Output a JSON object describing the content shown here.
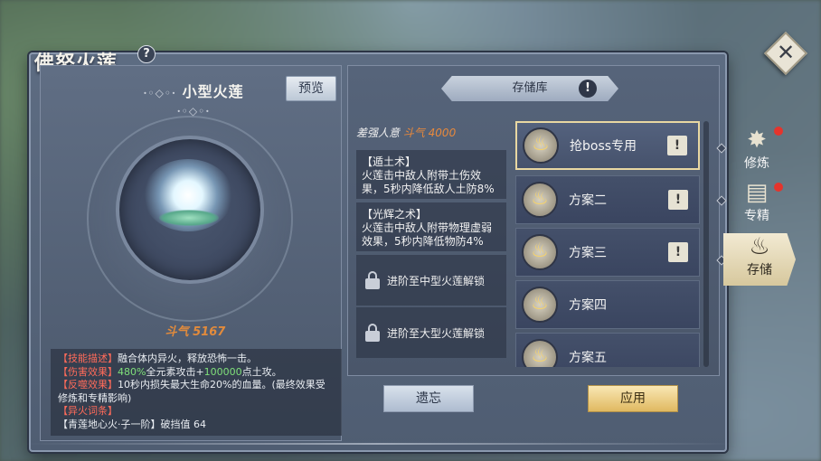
{
  "window": {
    "title": "佛怒火莲",
    "help_icon": "?",
    "close_icon": "✕"
  },
  "left": {
    "skill_name": "小型火莲",
    "preview_label": "预览",
    "douqi": "斗气 5167",
    "description": {
      "tag1": "【技能描述】",
      "text1": "融合体内异火，释放恐怖一击。",
      "tag2": "【伤害效果】",
      "pct": "480%",
      "text2a": "全元素攻击+",
      "num": "100000",
      "text2b": "点土攻。",
      "tag3": "【反噬效果】",
      "text3": "10秒内损失最大生命20%的血量。(最终效果受修炼和专精影响)",
      "tag4": "【异火词条】",
      "text4": "【青莲地心火·子一阶】破挡值 64"
    }
  },
  "middle": {
    "tab_label": "存储库",
    "tab_alert": "!",
    "requirement_prefix": "差强人意",
    "requirement_value": "斗气 4000",
    "skills": [
      {
        "title": "【遁土术】",
        "desc": "火莲击中敌人附带土伤效果，5秒内降低敌人土防8%"
      },
      {
        "title": "【光辉之术】",
        "desc": "火莲击中敌人附带物理虚弱效果，5秒内降低物防4%"
      }
    ],
    "locks": [
      {
        "label": "进阶至中型火莲解锁"
      },
      {
        "label": "进阶至大型火莲解锁"
      }
    ],
    "plans": [
      {
        "label": "抢boss专用",
        "edit": "!"
      },
      {
        "label": "方案二",
        "edit": "!"
      },
      {
        "label": "方案三",
        "edit": "!"
      },
      {
        "label": "方案四"
      },
      {
        "label": "方案五"
      }
    ],
    "forget_label": "遗忘",
    "apply_label": "应用"
  },
  "side_tabs": [
    {
      "label": "修炼",
      "icon": "cultivate-icon",
      "has_dot": true
    },
    {
      "label": "专精",
      "icon": "book-icon",
      "has_dot": true
    },
    {
      "label": "存储",
      "icon": "storage-icon",
      "active": true
    }
  ],
  "colors": {
    "accent_orange": "#e28b3c",
    "red_tag": "#ff6b5a",
    "green_value": "#7fe07a",
    "gold_button": "#e0b961",
    "notify_dot": "#e5342c"
  }
}
